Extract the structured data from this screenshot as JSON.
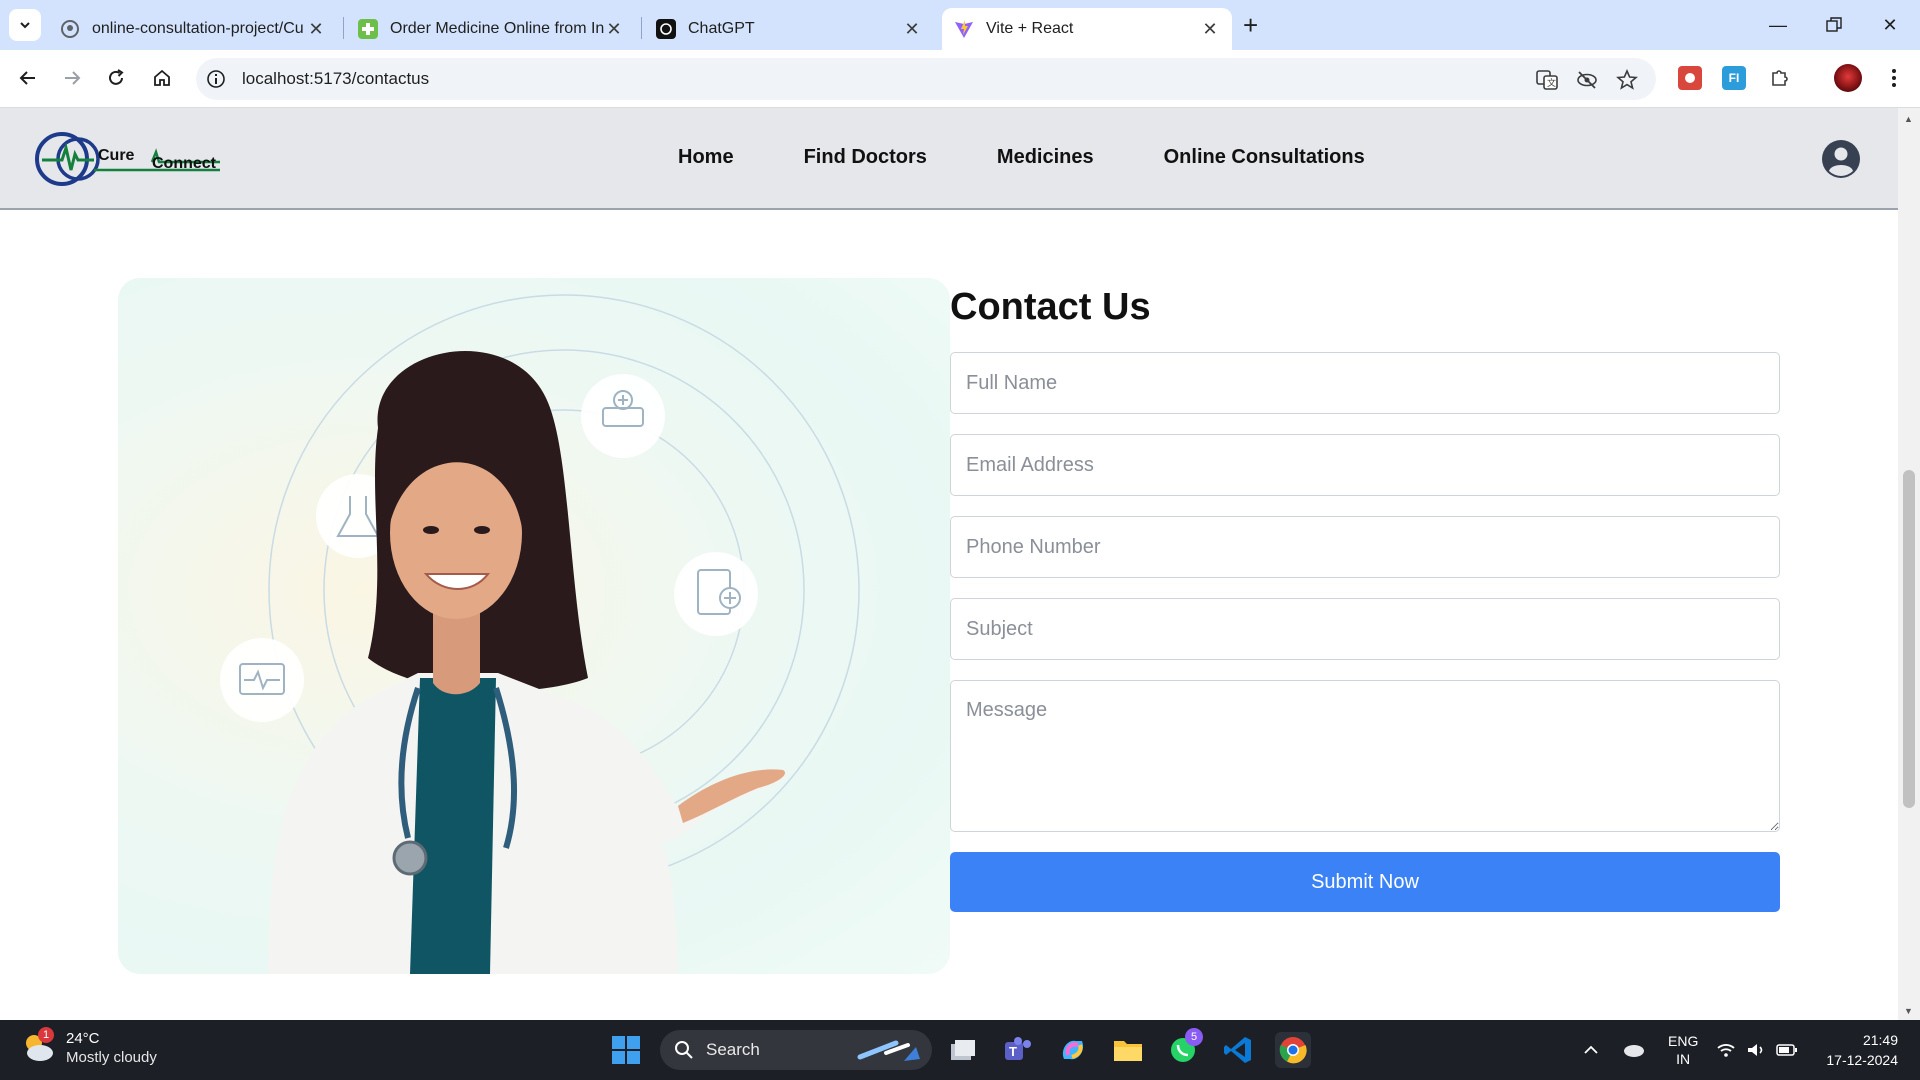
{
  "browser": {
    "tabs": [
      {
        "title": "online-consultation-project/Cu",
        "favicon": "github-icon"
      },
      {
        "title": "Order Medicine Online from Inc",
        "favicon": "pharmacy-icon"
      },
      {
        "title": "ChatGPT",
        "favicon": "chatgpt-icon"
      },
      {
        "title": "Vite + React",
        "favicon": "vite-icon",
        "active": true
      }
    ],
    "url": "localhost:5173/contactus"
  },
  "site": {
    "logo": {
      "word1": "Cure",
      "word2": "Connect",
      "colors": {
        "ring": "#1e3a8a",
        "accent": "#15803d"
      }
    },
    "nav": [
      "Home",
      "Find Doctors",
      "Medicines",
      "Online Consultations"
    ]
  },
  "contact": {
    "title": "Contact Us",
    "placeholders": {
      "full_name": "Full Name",
      "email": "Email Address",
      "phone": "Phone Number",
      "subject": "Subject",
      "message": "Message"
    },
    "submit_label": "Submit Now",
    "accent_color": "#3b82f6"
  },
  "taskbar": {
    "weather": {
      "temp": "24°C",
      "condition": "Mostly cloudy",
      "badge": "1"
    },
    "search_label": "Search",
    "whatsapp_badge": "5",
    "language": {
      "line1": "ENG",
      "line2": "IN"
    },
    "clock": {
      "time": "21:49",
      "date": "17-12-2024"
    }
  }
}
